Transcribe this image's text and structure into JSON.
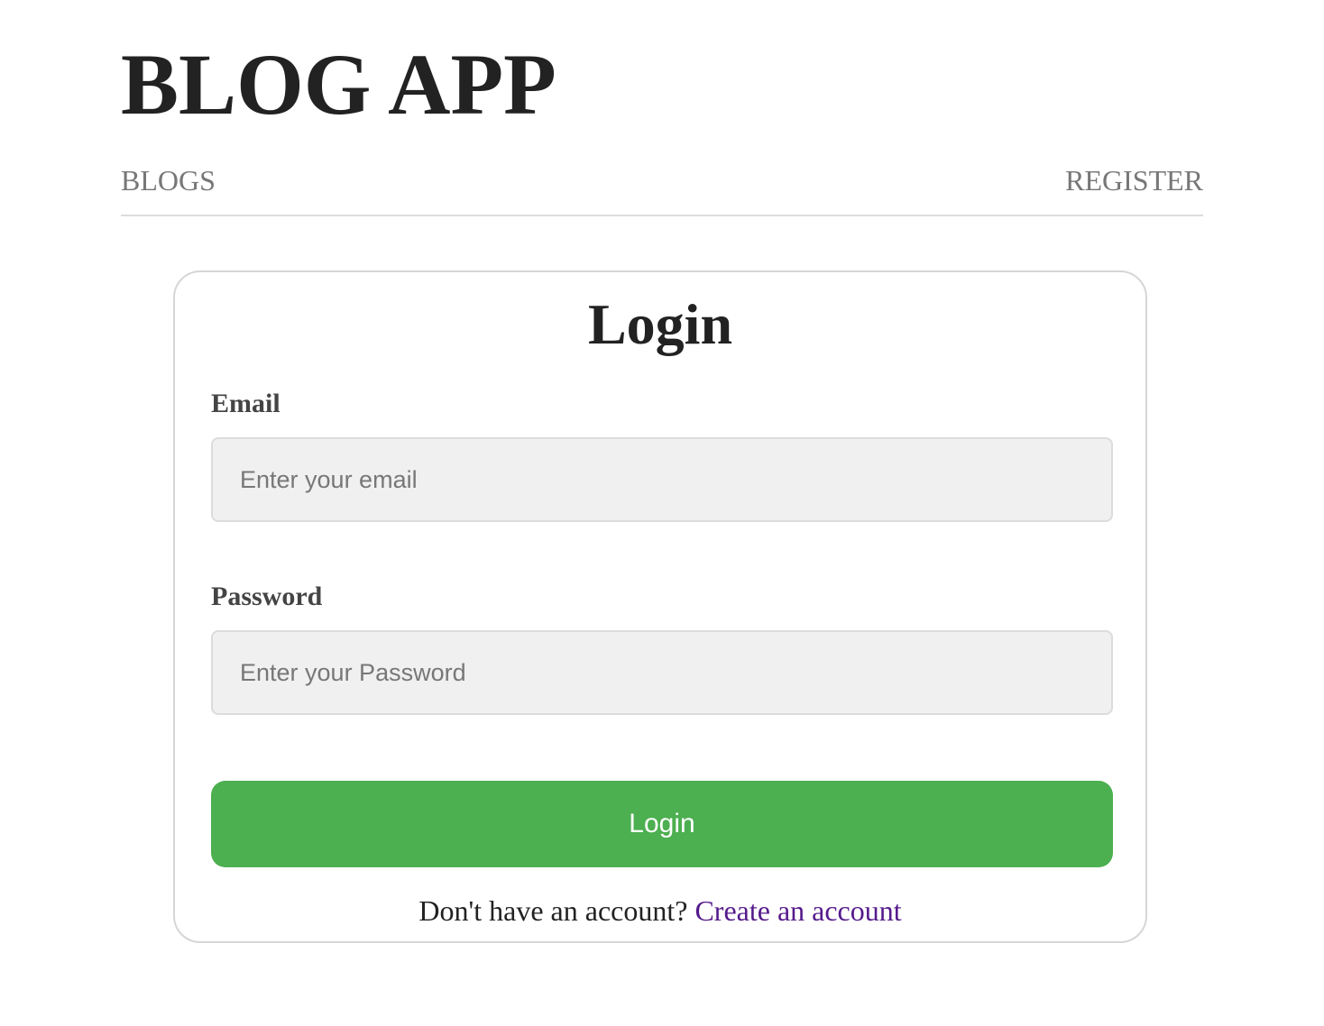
{
  "header": {
    "title": "BLOG APP"
  },
  "nav": {
    "blogs_label": "BLOGS",
    "register_label": "REGISTER"
  },
  "login_form": {
    "title": "Login",
    "email_label": "Email",
    "email_placeholder": "Enter your email",
    "email_value": "",
    "password_label": "Password",
    "password_placeholder": "Enter your Password",
    "password_value": "",
    "submit_label": "Login",
    "signup_prompt": "Don't have an account?",
    "signup_link_label": "Create an account"
  },
  "colors": {
    "button_bg": "#4caf50",
    "link_visited": "#551a8b",
    "nav_text": "#777777"
  }
}
